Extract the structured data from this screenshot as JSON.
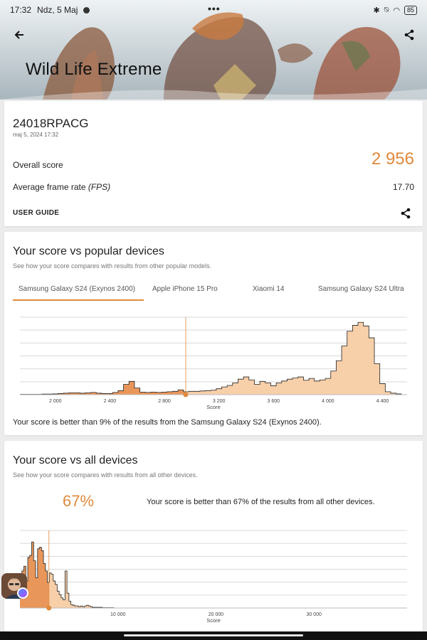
{
  "status_bar": {
    "time": "17:32",
    "date": "Ndz, 5 Maj",
    "battery": "85"
  },
  "header": {
    "title": "Wild Life Extreme"
  },
  "result": {
    "device": "24018RPACG",
    "date": "maj 5, 2024 17:32",
    "overall_label": "Overall score",
    "overall_value": "2 956",
    "fps_label": "Average frame rate",
    "fps_unit": "(FPS)",
    "fps_value": "17.70",
    "user_guide": "USER GUIDE"
  },
  "popular": {
    "title": "Your score vs popular devices",
    "subtitle": "See how your score compares with results from other popular models.",
    "tabs": [
      "Samsung Galaxy S24 (Exynos 2400)",
      "Apple iPhone 15 Pro",
      "Xiaomi 14",
      "Samsung Galaxy S24 Ultra"
    ],
    "active_tab": 0,
    "caption": "Your score is better than 9% of the results from the Samsung Galaxy S24 (Exynos 2400)."
  },
  "all_devices": {
    "title": "Your score vs all devices",
    "subtitle": "See how your score compares with results from all other devices.",
    "percentile": "67%",
    "caption": "Your score is better than 67% of the results from all other devices."
  },
  "colors": {
    "accent": "#e08a3c",
    "fill": "#f7cfa9",
    "fill_dark": "#e9965a"
  },
  "chart_data": [
    {
      "type": "area",
      "title": "Your score vs popular devices",
      "xlabel": "Score",
      "xlim": [
        1740,
        4580
      ],
      "x_ticks": [
        "2 000",
        "2 400",
        "2 800",
        "3 200",
        "3 600",
        "4 000",
        "4 400"
      ],
      "x_tick_values": [
        2000,
        2400,
        2800,
        3200,
        3600,
        4000,
        4400
      ],
      "your_score": 2956,
      "bin_width": 40,
      "x": [
        1760,
        1800,
        1840,
        1880,
        1920,
        1960,
        2000,
        2040,
        2080,
        2120,
        2160,
        2200,
        2240,
        2280,
        2320,
        2360,
        2400,
        2440,
        2480,
        2520,
        2560,
        2600,
        2640,
        2680,
        2720,
        2760,
        2800,
        2840,
        2880,
        2920,
        2960,
        3000,
        3040,
        3080,
        3120,
        3160,
        3200,
        3240,
        3280,
        3320,
        3360,
        3400,
        3440,
        3480,
        3520,
        3560,
        3600,
        3640,
        3680,
        3720,
        3760,
        3800,
        3840,
        3880,
        3920,
        3960,
        4000,
        4040,
        4080,
        4120,
        4160,
        4200,
        4240,
        4280,
        4320,
        4360,
        4400,
        4440,
        4480,
        4520
      ],
      "values": [
        0.5,
        0.5,
        0.5,
        0.5,
        0.8,
        0.8,
        1.0,
        1.5,
        2.0,
        2.5,
        2.5,
        2.0,
        2.5,
        3.0,
        2.0,
        1.5,
        1.5,
        3.0,
        5.5,
        14.0,
        18.0,
        9.0,
        3.5,
        3.0,
        3.5,
        3.0,
        3.5,
        4.0,
        4.5,
        6.5,
        4.0,
        4.5,
        4.5,
        5.0,
        5.5,
        6.0,
        8.0,
        10.5,
        12.5,
        16.0,
        21.0,
        24.0,
        20.0,
        14.0,
        18.0,
        16.0,
        12.0,
        16.0,
        18.5,
        21.0,
        22.5,
        24.0,
        19.5,
        22.0,
        18.5,
        20.0,
        22.0,
        32.0,
        46.0,
        66.0,
        86.0,
        94.0,
        98.0,
        93.0,
        77.0,
        42.0,
        15.0,
        4.0,
        2.0,
        1.0
      ],
      "ylim": [
        0,
        105
      ]
    },
    {
      "type": "area",
      "title": "Your score vs all devices",
      "xlabel": "Score",
      "xlim": [
        0,
        39500
      ],
      "x_ticks": [
        "10 000",
        "20 000",
        "30 000"
      ],
      "x_tick_values": [
        10000,
        20000,
        30000
      ],
      "your_score": 2956,
      "bin_width": 200,
      "x": [
        100,
        300,
        500,
        700,
        900,
        1100,
        1300,
        1500,
        1700,
        1900,
        2100,
        2300,
        2500,
        2700,
        2900,
        3100,
        3300,
        3500,
        3700,
        3900,
        4100,
        4300,
        4500,
        4700,
        4900,
        5100,
        5300,
        5500,
        5700,
        5900,
        6100,
        6300,
        6500,
        6700,
        6900,
        7100,
        7300,
        7500,
        7700,
        7900,
        8100,
        8300,
        8500,
        8700,
        8900,
        9100,
        9300,
        9500
      ],
      "values": [
        20,
        55,
        62,
        40,
        75,
        78,
        98,
        70,
        45,
        88,
        90,
        85,
        66,
        55,
        38,
        52,
        50,
        40,
        35,
        25,
        20,
        15,
        12,
        55,
        22,
        10,
        5,
        4,
        3,
        3,
        2,
        3,
        2,
        3,
        4,
        3,
        2,
        1,
        1,
        1,
        1,
        1,
        0.5,
        0.5,
        0.5,
        0.5,
        0.5,
        0.5
      ],
      "ylim": [
        0,
        115
      ]
    }
  ]
}
